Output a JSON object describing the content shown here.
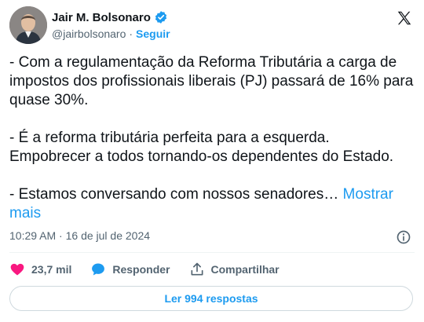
{
  "author": {
    "name": "Jair M. Bolsonaro",
    "handle": "@jairbolsonaro",
    "separator": "·",
    "follow_label": "Seguir"
  },
  "tweet": {
    "paragraphs": [
      "- Com a regulamentação da Reforma Tributária a carga de impostos dos profissionais liberais (PJ) passará de 16% para quase 30%.",
      "- É a reforma tributária perfeita para a esquerda. Empobrecer a todos tornando-os dependentes do Estado.",
      "- Estamos conversando com nossos senadores…"
    ],
    "show_more": "Mostrar mais"
  },
  "meta": {
    "time": "10:29 AM",
    "separator": "·",
    "date": "16 de jul de 2024"
  },
  "actions": {
    "likes": "23,7 mil",
    "reply_label": "Responder",
    "share_label": "Compartilhar"
  },
  "replies_button": "Ler 994 respostas",
  "colors": {
    "accent": "#1d9bf0",
    "like": "#f91880",
    "secondary_text": "#536471",
    "text": "#0f1419",
    "border": "#cfd9de"
  },
  "icons": [
    "verified-badge-icon",
    "x-logo-icon",
    "info-icon",
    "heart-icon",
    "reply-bubble-icon",
    "share-icon"
  ]
}
